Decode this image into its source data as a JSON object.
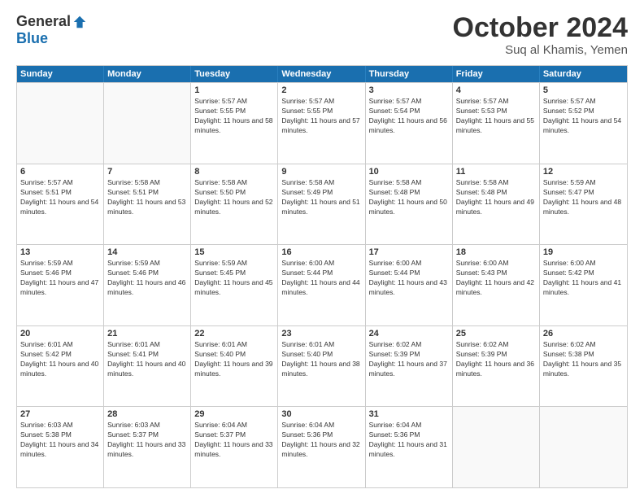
{
  "logo": {
    "general": "General",
    "blue": "Blue"
  },
  "title": "October 2024",
  "location": "Suq al Khamis, Yemen",
  "days_of_week": [
    "Sunday",
    "Monday",
    "Tuesday",
    "Wednesday",
    "Thursday",
    "Friday",
    "Saturday"
  ],
  "weeks": [
    [
      {
        "day": "",
        "info": ""
      },
      {
        "day": "",
        "info": ""
      },
      {
        "day": "1",
        "info": "Sunrise: 5:57 AM\nSunset: 5:55 PM\nDaylight: 11 hours and 58 minutes."
      },
      {
        "day": "2",
        "info": "Sunrise: 5:57 AM\nSunset: 5:55 PM\nDaylight: 11 hours and 57 minutes."
      },
      {
        "day": "3",
        "info": "Sunrise: 5:57 AM\nSunset: 5:54 PM\nDaylight: 11 hours and 56 minutes."
      },
      {
        "day": "4",
        "info": "Sunrise: 5:57 AM\nSunset: 5:53 PM\nDaylight: 11 hours and 55 minutes."
      },
      {
        "day": "5",
        "info": "Sunrise: 5:57 AM\nSunset: 5:52 PM\nDaylight: 11 hours and 54 minutes."
      }
    ],
    [
      {
        "day": "6",
        "info": "Sunrise: 5:57 AM\nSunset: 5:51 PM\nDaylight: 11 hours and 54 minutes."
      },
      {
        "day": "7",
        "info": "Sunrise: 5:58 AM\nSunset: 5:51 PM\nDaylight: 11 hours and 53 minutes."
      },
      {
        "day": "8",
        "info": "Sunrise: 5:58 AM\nSunset: 5:50 PM\nDaylight: 11 hours and 52 minutes."
      },
      {
        "day": "9",
        "info": "Sunrise: 5:58 AM\nSunset: 5:49 PM\nDaylight: 11 hours and 51 minutes."
      },
      {
        "day": "10",
        "info": "Sunrise: 5:58 AM\nSunset: 5:48 PM\nDaylight: 11 hours and 50 minutes."
      },
      {
        "day": "11",
        "info": "Sunrise: 5:58 AM\nSunset: 5:48 PM\nDaylight: 11 hours and 49 minutes."
      },
      {
        "day": "12",
        "info": "Sunrise: 5:59 AM\nSunset: 5:47 PM\nDaylight: 11 hours and 48 minutes."
      }
    ],
    [
      {
        "day": "13",
        "info": "Sunrise: 5:59 AM\nSunset: 5:46 PM\nDaylight: 11 hours and 47 minutes."
      },
      {
        "day": "14",
        "info": "Sunrise: 5:59 AM\nSunset: 5:46 PM\nDaylight: 11 hours and 46 minutes."
      },
      {
        "day": "15",
        "info": "Sunrise: 5:59 AM\nSunset: 5:45 PM\nDaylight: 11 hours and 45 minutes."
      },
      {
        "day": "16",
        "info": "Sunrise: 6:00 AM\nSunset: 5:44 PM\nDaylight: 11 hours and 44 minutes."
      },
      {
        "day": "17",
        "info": "Sunrise: 6:00 AM\nSunset: 5:44 PM\nDaylight: 11 hours and 43 minutes."
      },
      {
        "day": "18",
        "info": "Sunrise: 6:00 AM\nSunset: 5:43 PM\nDaylight: 11 hours and 42 minutes."
      },
      {
        "day": "19",
        "info": "Sunrise: 6:00 AM\nSunset: 5:42 PM\nDaylight: 11 hours and 41 minutes."
      }
    ],
    [
      {
        "day": "20",
        "info": "Sunrise: 6:01 AM\nSunset: 5:42 PM\nDaylight: 11 hours and 40 minutes."
      },
      {
        "day": "21",
        "info": "Sunrise: 6:01 AM\nSunset: 5:41 PM\nDaylight: 11 hours and 40 minutes."
      },
      {
        "day": "22",
        "info": "Sunrise: 6:01 AM\nSunset: 5:40 PM\nDaylight: 11 hours and 39 minutes."
      },
      {
        "day": "23",
        "info": "Sunrise: 6:01 AM\nSunset: 5:40 PM\nDaylight: 11 hours and 38 minutes."
      },
      {
        "day": "24",
        "info": "Sunrise: 6:02 AM\nSunset: 5:39 PM\nDaylight: 11 hours and 37 minutes."
      },
      {
        "day": "25",
        "info": "Sunrise: 6:02 AM\nSunset: 5:39 PM\nDaylight: 11 hours and 36 minutes."
      },
      {
        "day": "26",
        "info": "Sunrise: 6:02 AM\nSunset: 5:38 PM\nDaylight: 11 hours and 35 minutes."
      }
    ],
    [
      {
        "day": "27",
        "info": "Sunrise: 6:03 AM\nSunset: 5:38 PM\nDaylight: 11 hours and 34 minutes."
      },
      {
        "day": "28",
        "info": "Sunrise: 6:03 AM\nSunset: 5:37 PM\nDaylight: 11 hours and 33 minutes."
      },
      {
        "day": "29",
        "info": "Sunrise: 6:04 AM\nSunset: 5:37 PM\nDaylight: 11 hours and 33 minutes."
      },
      {
        "day": "30",
        "info": "Sunrise: 6:04 AM\nSunset: 5:36 PM\nDaylight: 11 hours and 32 minutes."
      },
      {
        "day": "31",
        "info": "Sunrise: 6:04 AM\nSunset: 5:36 PM\nDaylight: 11 hours and 31 minutes."
      },
      {
        "day": "",
        "info": ""
      },
      {
        "day": "",
        "info": ""
      }
    ]
  ]
}
